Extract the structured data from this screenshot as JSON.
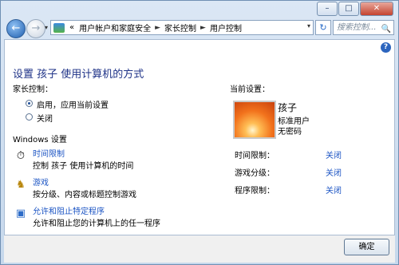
{
  "caption": {
    "minimize": "–",
    "maximize": "□",
    "close": "✕"
  },
  "nav": {
    "back_glyph": "←",
    "forward_glyph": "→",
    "drop_glyph": "▾",
    "crumbs": [
      "«",
      "用户帐户和家庭安全",
      "家长控制",
      "用户控制"
    ],
    "crumb_sep": "►",
    "refresh_glyph": "↻",
    "search_placeholder": "搜索控制...",
    "search_glyph": "🔍"
  },
  "help_glyph": "?",
  "page_title": "设置 孩子 使用计算机的方式",
  "parental_control": {
    "label": "家长控制：",
    "options": [
      {
        "label": "启用，应用当前设置",
        "checked": true
      },
      {
        "label": "关闭",
        "checked": false
      }
    ]
  },
  "windows_settings": {
    "label": "Windows 设置",
    "items": [
      {
        "title": "时间限制",
        "desc": "控制 孩子 使用计算机的时间",
        "icon": "clock-icon",
        "glyph": "⏱"
      },
      {
        "title": "游戏",
        "desc": "按分级、内容或标题控制游戏",
        "icon": "game-trophy-icon",
        "glyph": "♞"
      },
      {
        "title": "允许和阻止特定程序",
        "desc": "允许和阻止您的计算机上的任一程序",
        "icon": "program-icon",
        "glyph": "▣"
      }
    ]
  },
  "current_settings": {
    "label": "当前设置：",
    "user": {
      "name": "孩子",
      "role": "标准用户",
      "password": "无密码"
    },
    "rows": [
      {
        "label": "时间限制：",
        "value": "关闭"
      },
      {
        "label": "游戏分级：",
        "value": "关闭"
      },
      {
        "label": "程序限制：",
        "value": "关闭"
      }
    ]
  },
  "ok_label": "确定"
}
